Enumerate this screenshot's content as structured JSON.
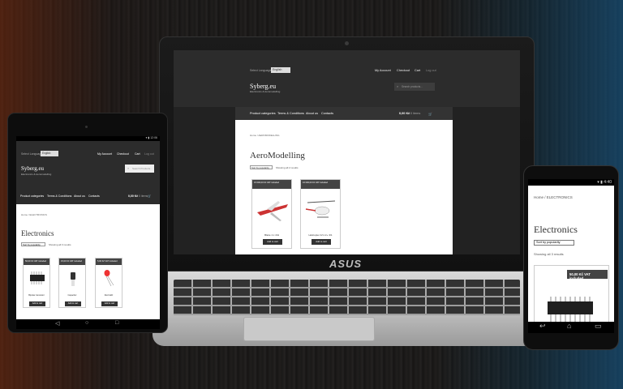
{
  "laptop": {
    "brand": "ASUS",
    "site": {
      "language_label": "Select Language:",
      "language_value": "English",
      "nav": [
        "My Account",
        "Checkout",
        "Cart",
        "Log out"
      ],
      "logo": "Syberg.eu",
      "tagline": "Electronics & Aeromodelling",
      "search_placeholder": "Search products…",
      "menu": [
        "Product categories",
        "Terms & Conditions",
        "About us",
        "Contacts"
      ],
      "cart_total": "0,00 Kč",
      "cart_items": "0 items",
      "breadcrumb": "Home / AEROMODELLING",
      "page_title": "AeroModelling",
      "sort_value": "Sort by popularity",
      "result_count": "Showing all 2 results",
      "products": [
        {
          "badge": "15 000,00 Kč VAT included",
          "name": "Blaze 1:x 4/H",
          "add": "Add to cart"
        },
        {
          "badge": "16 000,00 Kč VAT included",
          "name": "Helicopter 4/1 cz+ 3/1",
          "add": "Add to cart"
        }
      ]
    }
  },
  "tablet": {
    "status_time": "12:06",
    "site": {
      "language_label": "Select Language:",
      "language_value": "English",
      "nav": [
        "My Account",
        "Checkout",
        "Cart",
        "Log out"
      ],
      "logo": "Syberg.eu",
      "tagline": "Electronics & Aeromodelling",
      "search_placeholder": "Search Products…",
      "menu": [
        "Product categories",
        "Terms & Conditions",
        "About us",
        "Contacts"
      ],
      "cart_total": "0,00 Kč",
      "cart_items": "0 items",
      "breadcrumb": "Home / ELECTRONICS",
      "page_title": "Electronics",
      "sort_value": "Sort by popularity",
      "result_count": "Showing all 3 results",
      "products": [
        {
          "badge": "50,00 Kč VAT included",
          "name": "Bipolar transistor",
          "add": "Add to cart"
        },
        {
          "badge": "15,00 Kč VAT included",
          "name": "Capacitor",
          "add": "Add to cart"
        },
        {
          "badge": "5,00 Kč VAT included",
          "name": "Red LED",
          "add": "Add to cart"
        }
      ]
    }
  },
  "phone": {
    "status_time": "4:40",
    "site": {
      "breadcrumb": "Home / ELECTRONICS",
      "page_title": "Electronics",
      "sort_value": "Sort by popularity",
      "result_count": "Showing all 3 results",
      "first_badge": "50,00 Kč VAT included"
    }
  }
}
